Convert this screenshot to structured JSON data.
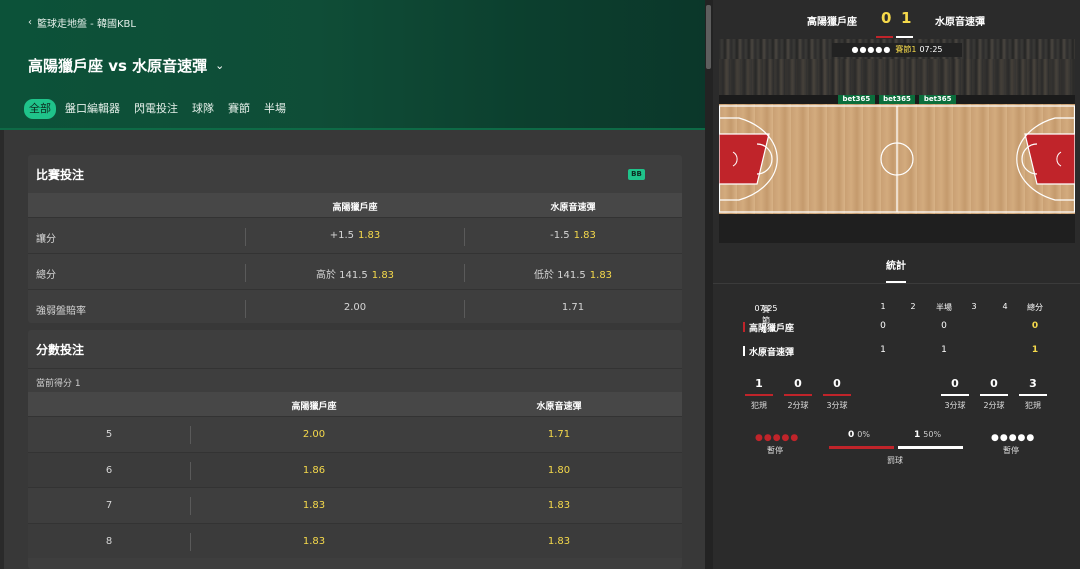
{
  "header": {
    "breadcrumb": "籃球走地盤 - 韓國KBL",
    "match_title": "高陽獵戶座 vs 水原音速彈",
    "tabs": [
      {
        "label": "全部",
        "active": true
      },
      {
        "label": "盤口編輯器",
        "active": false
      },
      {
        "label": "閃電投注",
        "active": false
      },
      {
        "label": "球隊",
        "active": false
      },
      {
        "label": "賽節",
        "active": false
      },
      {
        "label": "半場",
        "active": false
      }
    ]
  },
  "match_bets": {
    "title": "比賽投注",
    "badge": "BB",
    "col_home": "高陽獵戶座",
    "col_away": "水原音速彈",
    "rows": [
      {
        "label": "讓分",
        "home_line": "+1.5",
        "home_odds": "1.83",
        "away_line": "-1.5",
        "away_odds": "1.83"
      },
      {
        "label": "總分",
        "home_line": "高於 141.5",
        "home_odds": "1.83",
        "away_line": "低於 141.5",
        "away_odds": "1.83"
      },
      {
        "label": "強弱盤賠率",
        "home_line": "",
        "home_odds": "2.00",
        "away_line": "",
        "away_odds": "1.71"
      }
    ]
  },
  "score_bets": {
    "title": "分數投注",
    "note": "當前得分 1",
    "col_home": "高陽獵戶座",
    "col_away": "水原音速彈",
    "rows": [
      {
        "num": "5",
        "home": "2.00",
        "away": "1.71"
      },
      {
        "num": "6",
        "home": "1.86",
        "away": "1.80"
      },
      {
        "num": "7",
        "home": "1.83",
        "away": "1.83"
      },
      {
        "num": "8",
        "home": "1.83",
        "away": "1.83"
      }
    ]
  },
  "scoreboard": {
    "home_name": "高陽獵戶座",
    "away_name": "水原音速彈",
    "home_score": "0",
    "away_score": "1",
    "court_dots": "●●●●●",
    "court_period": "賽節1",
    "court_time": "07:25",
    "banners": [
      "bet365",
      "bet365",
      "bet365"
    ]
  },
  "stats": {
    "tab_label": "統計",
    "period_label": "賽節1",
    "period_time": "07:25",
    "columns": [
      "1",
      "2",
      "半場",
      "3",
      "4",
      "總分"
    ],
    "home": {
      "name": "高陽獵戶座",
      "q1": "0",
      "half": "0",
      "total": "0"
    },
    "away": {
      "name": "水原音速彈",
      "q1": "1",
      "half": "1",
      "total": "1"
    },
    "home_blocks": [
      {
        "value": "1",
        "label": "犯規"
      },
      {
        "value": "0",
        "label": "2分球"
      },
      {
        "value": "0",
        "label": "3分球"
      }
    ],
    "away_blocks": [
      {
        "value": "0",
        "label": "3分球"
      },
      {
        "value": "0",
        "label": "2分球"
      },
      {
        "value": "3",
        "label": "犯規"
      }
    ],
    "timeout_label_home": "暫停",
    "timeout_label_away": "暫停",
    "timeout_dots": "●●●●●",
    "free_throw": {
      "label": "罰球",
      "home_value": "0",
      "home_pct": "0%",
      "away_value": "1",
      "away_pct": "50%"
    }
  },
  "colors": {
    "accent_green": "#1fc38a",
    "odds_yellow": "#f5d94b",
    "home_red": "#c0242a",
    "away_white": "#ffffff"
  }
}
